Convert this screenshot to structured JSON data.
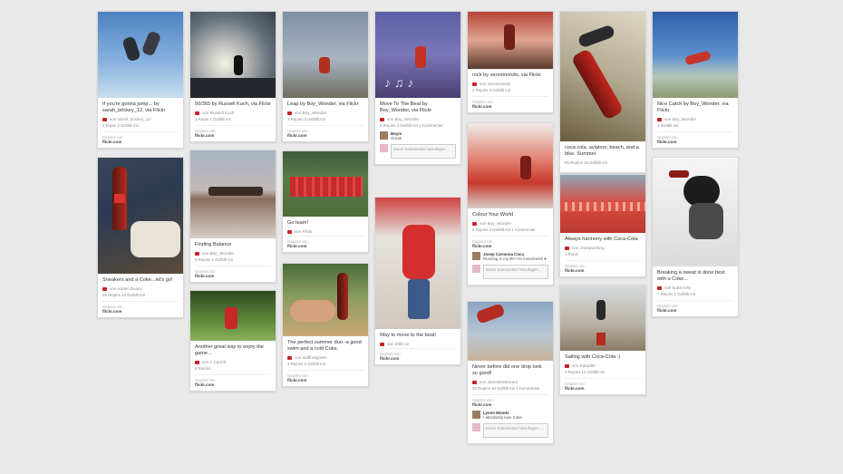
{
  "pins": [
    {
      "desc": "If you're gonna jump... by sarah_brickey_12, via Flickr",
      "via": "von sarah_brickey_13",
      "stats": "1 Repin  3 Gefällt mir",
      "src_label": "Gepinnt von",
      "src": "flickr.com"
    },
    {
      "desc": "Sneakers and a Coke...let's go!",
      "via": "von Adrien Evans",
      "stats": "36 Repins  13 Gefällt mir",
      "src_label": "Gepinnt von",
      "src": "flickr.com"
    },
    {
      "desc": "50/365 by Russell Kuch, via Flickr",
      "via": "von Russell Kuch",
      "stats": "1 Repin  1 Gefällt mir",
      "src_label": "Gepinnt von",
      "src": "flickr.com"
    },
    {
      "desc": "Finding Balance",
      "via": "von Boy_Wonder",
      "stats": "6 Repins  1 Gefällt mir",
      "src_label": "Gepinnt von",
      "src": "flickr.com"
    },
    {
      "desc": "Another great way to enjoy the game...",
      "via": "von L Carroll",
      "stats": "5 Repins",
      "src_label": "Gepinnt von",
      "src": "flickr.com"
    },
    {
      "desc": "Leap by Boy_Wonder, via Flickr",
      "via": "von Boy_Wonder",
      "stats": "3 Repins  3 Gefällt mir",
      "src_label": "Gepinnt von",
      "src": "flickr.com"
    },
    {
      "desc": "Go team!",
      "via": "von Flickr",
      "stats": "",
      "src_label": "Gepinnt von",
      "src": "flickr.com"
    },
    {
      "desc": "The perfect summer duo--a good swim and a cold Coke.",
      "via": "von staffordgreen",
      "stats": "3 Repins  6 Gefällt mir",
      "src_label": "Gepinnt von",
      "src": "flickr.com"
    },
    {
      "desc": "Move To The Beat by Boy_Wonder, via Flickr",
      "via": "von Boy_Wonder",
      "stats": "4 Repins  3 Gefällt mir  1 Kommentar",
      "comment_name": "Boyre",
      "comment_text": "Great!",
      "input": "Einen Kommentar hinzufügen ...",
      "src_label": "Gepinnt von",
      "src": "flickr.com"
    },
    {
      "desc": "Way to move to the beat!",
      "via": "von 6SB-12",
      "stats": "",
      "src_label": "Gepinnt von",
      "src": "flickr.com"
    },
    {
      "desc": "rock by veromnondo, via Flickr",
      "via": "von veromnondo",
      "stats": "3 Repins  3 Gefällt mir",
      "src_label": "Gepinnt von",
      "src": "flickr.com"
    },
    {
      "desc": "Colour Your World",
      "via": "von Boy_Wonder",
      "stats": "8 Repins  3 Gefällt mir  1 Kommentar",
      "comment_name": "Josep Carmona Coca",
      "comment_text": "Running is my life! On movement! ♥",
      "input": "Einen Kommentar hinzufügen ...",
      "src_label": "Gepinnt von",
      "src": "flickr.com"
    },
    {
      "desc": "Never before did one drop look so good!",
      "via": "von JamesDesmond",
      "stats": "30 Repins  10 Gefällt mir  1 Kommentar",
      "comment_name": "Lynne Woods",
      "comment_text": "I absolutely love Coke",
      "input": "Einen Kommentar hinzufügen ...",
      "src_label": "Gepinnt von",
      "src": "flickr.com"
    },
    {
      "desc": "coca cola, aviators, beach, and a bike. Summer.",
      "via": "",
      "stats": "55 Repins  19 Gefällt mir",
      "src_label": "Gepinnt von",
      "src": "flickr.com"
    },
    {
      "desc": "Always harmony with Coca-Cola",
      "via": "von chaoyuiching",
      "stats": "1 Repin",
      "src_label": "Gepinnt von",
      "src": "flickr.com"
    },
    {
      "desc": "Sailing with Coca-Cola :)",
      "via": "von Kata290",
      "stats": "2 Repins  13 Gefällt mir",
      "src_label": "Gepinnt von",
      "src": "flickr.com"
    },
    {
      "desc": "Nice Catch by Boy_Wonder, via Flickr",
      "via": "von Boy_Wonder",
      "stats": "1 Gefällt mir",
      "src_label": "Gepinnt von",
      "src": "flickr.com"
    },
    {
      "desc": "Breaking a sweat is done best with a Coke...",
      "via": "von butch lelis",
      "stats": "7 Repins  1 Gefällt mir",
      "src_label": "Gepinnt von",
      "src": "flickr.com"
    }
  ]
}
